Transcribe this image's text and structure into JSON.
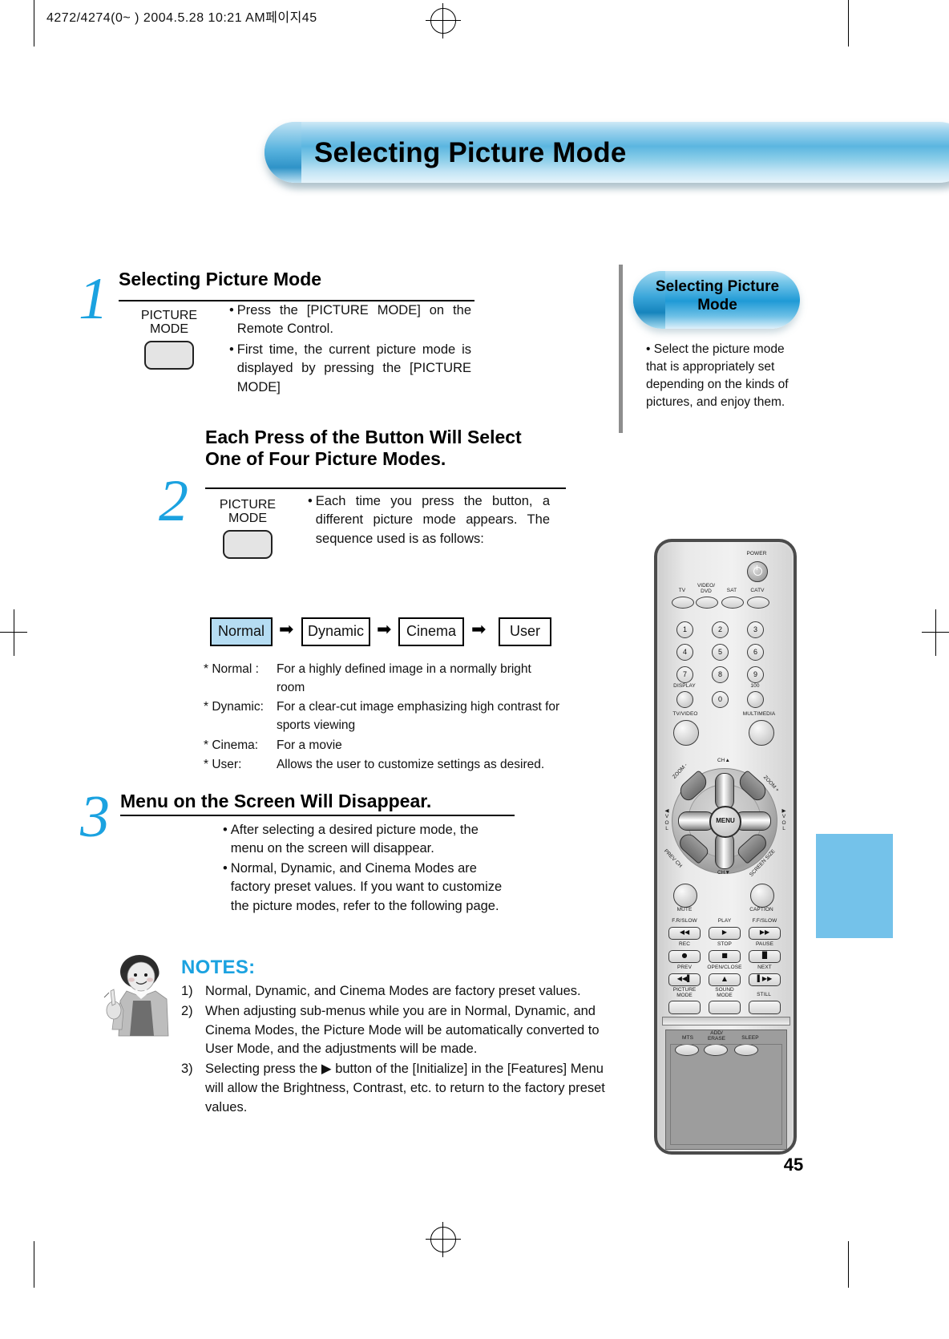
{
  "print_header": "4272/4274(0~ )  2004.5.28 10:21 AM페이지45",
  "page_title": "Selecting Picture Mode",
  "page_number": "45",
  "steps": [
    {
      "number": "1",
      "title": "Selecting Picture Mode",
      "button_label_line1": "PICTURE",
      "button_label_line2": "MODE",
      "bullets": [
        "Press the [PICTURE MODE] on the Remote Control.",
        "First time, the current picture mode is displayed by pressing the [PICTURE MODE]"
      ]
    },
    {
      "number": "2",
      "title_line1": "Each Press of the Button Will Select",
      "title_line2": "One of Four Picture Modes.",
      "button_label_line1": "PICTURE",
      "button_label_line2": "MODE",
      "bullets": [
        "Each time you press the button, a different picture mode appears. The sequence used is as follows:"
      ]
    },
    {
      "number": "3",
      "title": "Menu on the Screen Will Disappear.",
      "bullets": [
        "After selecting a desired picture mode, the menu on the screen will disappear.",
        "Normal, Dynamic, and Cinema Modes are factory preset values. If you want to customize the picture modes, refer to the following page."
      ]
    }
  ],
  "mode_sequence": {
    "arrow_glyph": "➡",
    "items": [
      {
        "label": "Normal",
        "selected": true
      },
      {
        "label": "Dynamic",
        "selected": false
      },
      {
        "label": "Cinema",
        "selected": false
      },
      {
        "label": "User",
        "selected": false
      }
    ]
  },
  "mode_descriptions": [
    {
      "key": "* Normal :",
      "text": "For a highly defined image in a normally bright room"
    },
    {
      "key": "* Dynamic:",
      "text": "For a clear-cut image emphasizing high contrast for sports viewing"
    },
    {
      "key": "* Cinema:",
      "text": "For a movie"
    },
    {
      "key": "* User:",
      "text": "Allows the user to customize settings as desired."
    }
  ],
  "sidebar": {
    "title_line1": "Selecting Picture",
    "title_line2": "Mode",
    "body": "• Select the picture mode that is appropriately set depending on the kinds of pictures, and enjoy them."
  },
  "notes": {
    "title": "NOTES:",
    "items": [
      {
        "index": "1)",
        "text": "Normal, Dynamic, and Cinema Modes are factory preset values."
      },
      {
        "index": "2)",
        "text": "When adjusting sub-menus while you are in Normal, Dynamic, and Cinema Modes, the Picture Mode will be automatically converted to User Mode, and the adjustments will be made."
      },
      {
        "index": "3)",
        "text": "Selecting press the ▶ button of the [Initialize] in the [Features] Menu will allow the Brightness, Contrast, etc. to return to the factory preset values."
      }
    ]
  },
  "remote": {
    "power_label": "POWER",
    "source_buttons": [
      "TV",
      "VIDEO/\nDVD",
      "SAT",
      "CATV"
    ],
    "source_labels": [
      {
        "l1": "TV",
        "l2": ""
      },
      {
        "l1": "VIDEO/",
        "l2": "DVD"
      },
      {
        "l1": "SAT",
        "l2": ""
      },
      {
        "l1": "CATV",
        "l2": ""
      }
    ],
    "numpad": [
      "1",
      "2",
      "3",
      "4",
      "5",
      "6",
      "7",
      "8",
      "9"
    ],
    "zero_row": {
      "display": "DISPLAY",
      "zero": "0",
      "hundred": "100"
    },
    "tv_video_label": "TV/VIDEO",
    "multimedia_label": "MULTIMEDIA",
    "nav": {
      "ch_up": "CH▲",
      "ch_down": "CH▼",
      "menu": "MENU",
      "zoom_minus": "ZOOM -",
      "zoom_plus": "ZOOM +",
      "prev_ch": "PREV CH",
      "screen_size": "SCREEN SIZE",
      "vol_left": "◀VOL",
      "vol_right": "▶VOL"
    },
    "mute_label": "MUTE",
    "caption_label": "CAPTION",
    "transport_rows": [
      [
        {
          "label": "F.R/SLOW",
          "glyph": "◀◀"
        },
        {
          "label": "PLAY",
          "glyph": "▶"
        },
        {
          "label": "F.F/SLOW",
          "glyph": "▶▶"
        }
      ],
      [
        {
          "label": "REC",
          "glyph": "●"
        },
        {
          "label": "STOP",
          "glyph": "■"
        },
        {
          "label": "PAUSE",
          "glyph": "▐▌"
        }
      ],
      [
        {
          "label": "PREV",
          "glyph": "◀◀▌"
        },
        {
          "label": "OPEN/CLOSE",
          "glyph": "▲"
        },
        {
          "label": "NEXT",
          "glyph": "▌▶▶"
        }
      ]
    ],
    "mode_row": [
      {
        "l1": "PICTURE",
        "l2": "MODE"
      },
      {
        "l1": "SOUND",
        "l2": "MODE"
      },
      {
        "l1": "STILL",
        "l2": ""
      }
    ],
    "lower_row": [
      {
        "l1": "MTS",
        "l2": ""
      },
      {
        "l1": "ADD/",
        "l2": "ERASE"
      },
      {
        "l1": "SLEEP",
        "l2": ""
      }
    ]
  },
  "colors": {
    "accent_blue": "#1ba2e0",
    "banner_blue": "#5bb6e0",
    "selected_mode_fill": "#b5dcf2",
    "edge_tab": "#74c2ea"
  }
}
